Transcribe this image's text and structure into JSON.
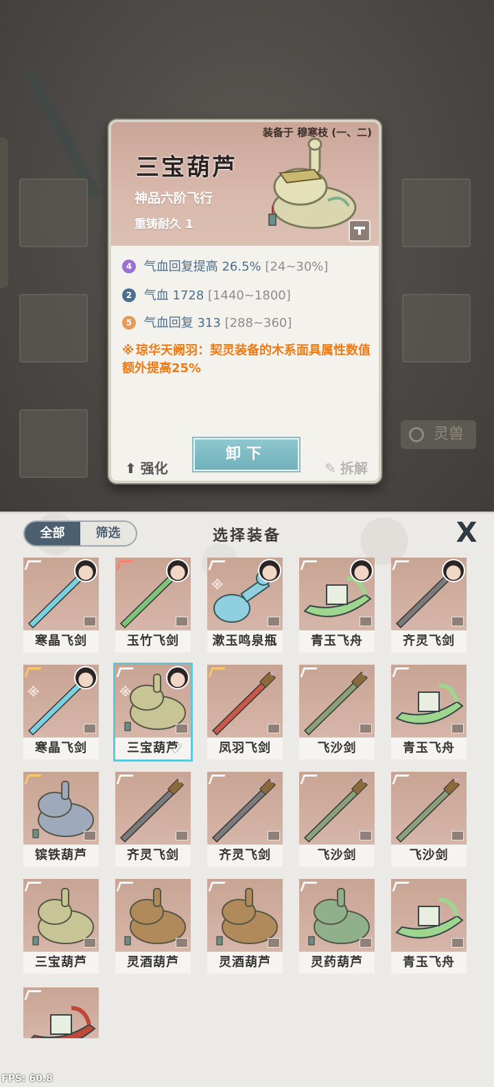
{
  "detail": {
    "equipped_by": "装备于 穆寒枝 (一、二)",
    "name": "三宝葫芦",
    "grade": "神品六阶飞行",
    "durability": "重铸耐久 1",
    "stats": [
      {
        "badge": "4",
        "label": "气血回复提高",
        "value": "26.5%",
        "range": "[24~30%]",
        "color": "#9a6fd6"
      },
      {
        "badge": "2",
        "label": "气血",
        "value": "1728",
        "range": "[1440~1800]",
        "color": "#4b6f8c"
      },
      {
        "badge": "5",
        "label": "气血回复",
        "value": "313",
        "range": "[288~360]",
        "color": "#e39a5a"
      }
    ],
    "special": "琼华天阙羽：契灵装备的木系面具属性数值额外提高25%",
    "buttons": {
      "strengthen": "强化",
      "unequip": "卸下",
      "dismantle": "拆解"
    }
  },
  "background": {
    "beast_tab": "灵兽"
  },
  "panel": {
    "filter": {
      "all": "全部",
      "screen": "筛选"
    },
    "title": "选择装备",
    "close": "X"
  },
  "items": [
    {
      "name": "寒晶飞剑",
      "type": "sword",
      "color": "#7ad0e0",
      "portrait": true,
      "wing": "white"
    },
    {
      "name": "玉竹飞剑",
      "type": "sword",
      "color": "#7fc27a",
      "portrait": true,
      "wing": "red"
    },
    {
      "name": "漱玉鸣泉瓶",
      "type": "bottle",
      "color": "#8fcfe0",
      "portrait": true,
      "wing": "white"
    },
    {
      "name": "青玉飞舟",
      "type": "boat",
      "color": "#9ed68f",
      "portrait": true,
      "wing": "white"
    },
    {
      "name": "齐灵飞剑",
      "type": "sword",
      "color": "#7a7a7a",
      "portrait": true,
      "wing": "white"
    },
    {
      "name": "寒晶飞剑",
      "type": "sword",
      "color": "#7ad0e0",
      "portrait": true,
      "wing": "gold"
    },
    {
      "name": "三宝葫芦",
      "type": "gourd",
      "color": "#c7c596",
      "portrait": true,
      "wing": "white",
      "selected": true
    },
    {
      "name": "凤羽飞剑",
      "type": "sword",
      "color": "#c8594a",
      "portrait": false,
      "wing": "gold"
    },
    {
      "name": "飞沙剑",
      "type": "sword",
      "color": "#8aa078",
      "portrait": false,
      "wing": "white"
    },
    {
      "name": "青玉飞舟",
      "type": "boat",
      "color": "#9ed68f",
      "portrait": false,
      "wing": "white"
    },
    {
      "name": "镔铁葫芦",
      "type": "gourd",
      "color": "#9eaabb",
      "portrait": false,
      "wing": "gold"
    },
    {
      "name": "齐灵飞剑",
      "type": "sword",
      "color": "#7a7a7a",
      "portrait": false,
      "wing": "white"
    },
    {
      "name": "齐灵飞剑",
      "type": "sword",
      "color": "#7a7a7a",
      "portrait": false,
      "wing": "white"
    },
    {
      "name": "飞沙剑",
      "type": "sword",
      "color": "#8aa078",
      "portrait": false,
      "wing": "white"
    },
    {
      "name": "飞沙剑",
      "type": "sword",
      "color": "#8aa078",
      "portrait": false,
      "wing": "white"
    },
    {
      "name": "三宝葫芦",
      "type": "gourd",
      "color": "#c7c596",
      "portrait": false,
      "wing": "white"
    },
    {
      "name": "灵酒葫芦",
      "type": "gourd",
      "color": "#b08a5a",
      "portrait": false,
      "wing": "white"
    },
    {
      "name": "灵酒葫芦",
      "type": "gourd",
      "color": "#b08a5a",
      "portrait": false,
      "wing": "white"
    },
    {
      "name": "灵药葫芦",
      "type": "gourd",
      "color": "#8fb08a",
      "portrait": false,
      "wing": "white"
    },
    {
      "name": "青玉飞舟",
      "type": "boat",
      "color": "#9ed68f",
      "portrait": false,
      "wing": "white"
    },
    {
      "name": "",
      "type": "boat",
      "color": "#c0483a",
      "portrait": false,
      "wing": "white"
    }
  ],
  "fps": "FPS: 60.8"
}
